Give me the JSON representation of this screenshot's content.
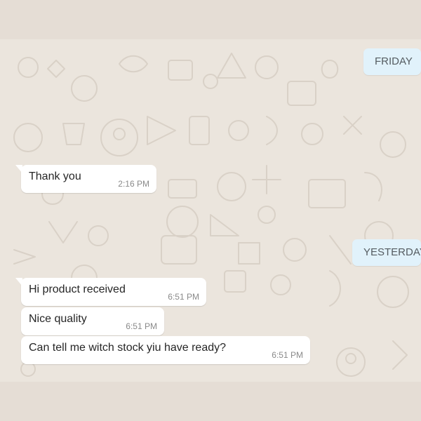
{
  "chat": {
    "date_chips": {
      "friday": "FRIDAY",
      "yesterday": "YESTERDAY"
    },
    "messages": [
      {
        "text": "Thank you",
        "time": "2:16 PM",
        "direction": "incoming"
      },
      {
        "text": "Hi product received",
        "time": "6:51 PM",
        "direction": "incoming"
      },
      {
        "text": "Nice quality",
        "time": "6:51 PM",
        "direction": "incoming"
      },
      {
        "text": "Can tell me witch stock yiu have ready?",
        "time": "6:51 PM",
        "direction": "incoming"
      }
    ]
  },
  "colors": {
    "outer_background": "#e5ddd5",
    "chat_background": "#ebe5dd",
    "bubble_incoming": "#ffffff",
    "date_chip": "#e1f2fb",
    "text": "#262626",
    "timestamp": "#8a8a8a"
  }
}
